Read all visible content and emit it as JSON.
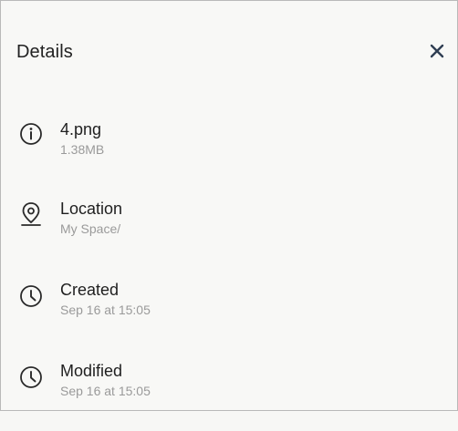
{
  "header": {
    "title": "Details",
    "close_icon": "close-icon"
  },
  "items": [
    {
      "icon": "info-icon",
      "label": "4.png",
      "value": "1.38MB"
    },
    {
      "icon": "location-pin-icon",
      "label": "Location",
      "value": "My Space/"
    },
    {
      "icon": "clock-icon",
      "label": "Created",
      "value": "Sep 16 at 15:05"
    },
    {
      "icon": "clock-icon",
      "label": "Modified",
      "value": "Sep 16 at 15:05"
    }
  ],
  "colors": {
    "background": "#f8f8f6",
    "text": "#1f1f1f",
    "secondary_text": "#9a9a9a",
    "close_icon": "#2f3e52"
  }
}
